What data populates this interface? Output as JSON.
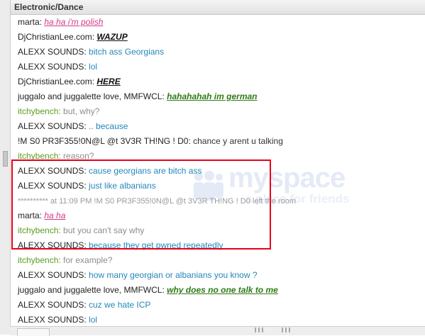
{
  "window": {
    "title": "Electronic/Dance"
  },
  "watermark": {
    "logo_text": "myspace",
    "tagline": "a place for friends"
  },
  "messages": [
    {
      "user": "marta:",
      "text": "ha ha i'm polish",
      "style": "pink"
    },
    {
      "user": "DjChristianLee.com:",
      "text": "WAZUP",
      "style": "black"
    },
    {
      "user": "ALEXX SOUNDS:",
      "text": "bitch ass Georgians",
      "style": "blue"
    },
    {
      "user": "ALEXX SOUNDS:",
      "text": "lol",
      "style": "blue"
    },
    {
      "user": "DjChristianLee.com:",
      "text": "HERE",
      "style": "black"
    },
    {
      "user": "juggalo and juggalette love, MMFWCL:",
      "text": "hahahahah im german",
      "style": "green"
    },
    {
      "user": "itchybench:",
      "text": "but, why?",
      "style": "grey",
      "user_style": "green"
    },
    {
      "user": "ALEXX SOUNDS:",
      "text": ".. because",
      "style": "blue"
    },
    {
      "user": "!M S0 PR3F355!0N@L @t 3V3R TH!NG ! D0:",
      "text": "chance y arent u talking",
      "style": "dark"
    },
    {
      "user": "itchybench:",
      "text": "reason?",
      "style": "grey",
      "user_style": "green"
    },
    {
      "user": "ALEXX SOUNDS:",
      "text": "cause georgians are bitch ass",
      "style": "blue"
    },
    {
      "user": "ALEXX SOUNDS:",
      "text": "just like albanians",
      "style": "blue"
    },
    {
      "user": "",
      "text": "********** at 11:09 PM !M S0 PR3F355!0N@L @t 3V3R TH!NG ! D0 left the room",
      "style": "sys"
    },
    {
      "user": "marta:",
      "text": "ha ha",
      "style": "pink"
    },
    {
      "user": "itchybench:",
      "text": "but you can't say why",
      "style": "grey",
      "user_style": "green"
    },
    {
      "user": "ALEXX SOUNDS:",
      "text": "because they get pwned repeatedly",
      "style": "blue"
    },
    {
      "user": "itchybench:",
      "text": "for example?",
      "style": "grey",
      "user_style": "green"
    },
    {
      "user": "ALEXX SOUNDS:",
      "text": "how many georgian or albanians you know ?",
      "style": "blue"
    },
    {
      "user": "juggalo and juggalette love, MMFWCL:",
      "text": "why does no one talk to me",
      "style": "green"
    },
    {
      "user": "ALEXX SOUNDS:",
      "text": "cuz we hate ICP",
      "style": "blue"
    },
    {
      "user": "ALEXX SOUNDS:",
      "text": "lol",
      "style": "blue"
    }
  ],
  "colors": {
    "highlight_border": "#e8001c",
    "blue_text": "#2288b9",
    "green_user": "#5a9e1e",
    "pink_text": "#d23a8a"
  }
}
